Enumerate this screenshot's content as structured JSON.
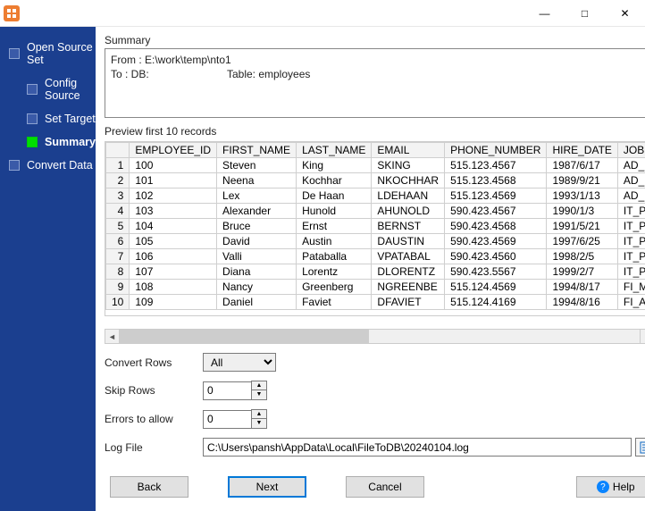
{
  "window": {
    "min": "—",
    "max": "□",
    "close": "✕"
  },
  "sidebar": {
    "items": [
      {
        "label": "Open Source Set",
        "level": 0,
        "active": false
      },
      {
        "label": "Config Source",
        "level": 1,
        "active": false
      },
      {
        "label": "Set Target",
        "level": 1,
        "active": false
      },
      {
        "label": "Summary",
        "level": 1,
        "active": true
      },
      {
        "label": "Convert Data",
        "level": 0,
        "active": false
      }
    ]
  },
  "summary": {
    "title": "Summary",
    "from": "From : E:\\work\\temp\\nto1",
    "to": "To : DB:",
    "table_label": "Table: employees"
  },
  "preview": {
    "title": "Preview first 10 records",
    "columns": [
      "EMPLOYEE_ID",
      "FIRST_NAME",
      "LAST_NAME",
      "EMAIL",
      "PHONE_NUMBER",
      "HIRE_DATE",
      "JOB"
    ],
    "rows": [
      [
        "100",
        "Steven",
        "King",
        "SKING",
        "515.123.4567",
        "1987/6/17",
        "AD_"
      ],
      [
        "101",
        "Neena",
        "Kochhar",
        "NKOCHHAR",
        "515.123.4568",
        "1989/9/21",
        "AD_"
      ],
      [
        "102",
        "Lex",
        "De Haan",
        "LDEHAAN",
        "515.123.4569",
        "1993/1/13",
        "AD_"
      ],
      [
        "103",
        "Alexander",
        "Hunold",
        "AHUNOLD",
        "590.423.4567",
        "1990/1/3",
        "IT_P"
      ],
      [
        "104",
        "Bruce",
        "Ernst",
        "BERNST",
        "590.423.4568",
        "1991/5/21",
        "IT_P"
      ],
      [
        "105",
        "David",
        "Austin",
        "DAUSTIN",
        "590.423.4569",
        "1997/6/25",
        "IT_P"
      ],
      [
        "106",
        "Valli",
        "Pataballa",
        "VPATABAL",
        "590.423.4560",
        "1998/2/5",
        "IT_P"
      ],
      [
        "107",
        "Diana",
        "Lorentz",
        "DLORENTZ",
        "590.423.5567",
        "1999/2/7",
        "IT_P"
      ],
      [
        "108",
        "Nancy",
        "Greenberg",
        "NGREENBE",
        "515.124.4569",
        "1994/8/17",
        "FI_M"
      ],
      [
        "109",
        "Daniel",
        "Faviet",
        "DFAVIET",
        "515.124.4169",
        "1994/8/16",
        "FI_A"
      ]
    ]
  },
  "form": {
    "convert_rows_label": "Convert Rows",
    "convert_rows_value": "All",
    "skip_rows_label": "Skip Rows",
    "skip_rows_value": "0",
    "errors_label": "Errors to allow",
    "errors_value": "0",
    "logfile_label": "Log File",
    "logfile_value": "C:\\Users\\pansh\\AppData\\Local\\FileToDB\\20240104.log"
  },
  "buttons": {
    "back": "Back",
    "next": "Next",
    "cancel": "Cancel",
    "help": "Help"
  }
}
